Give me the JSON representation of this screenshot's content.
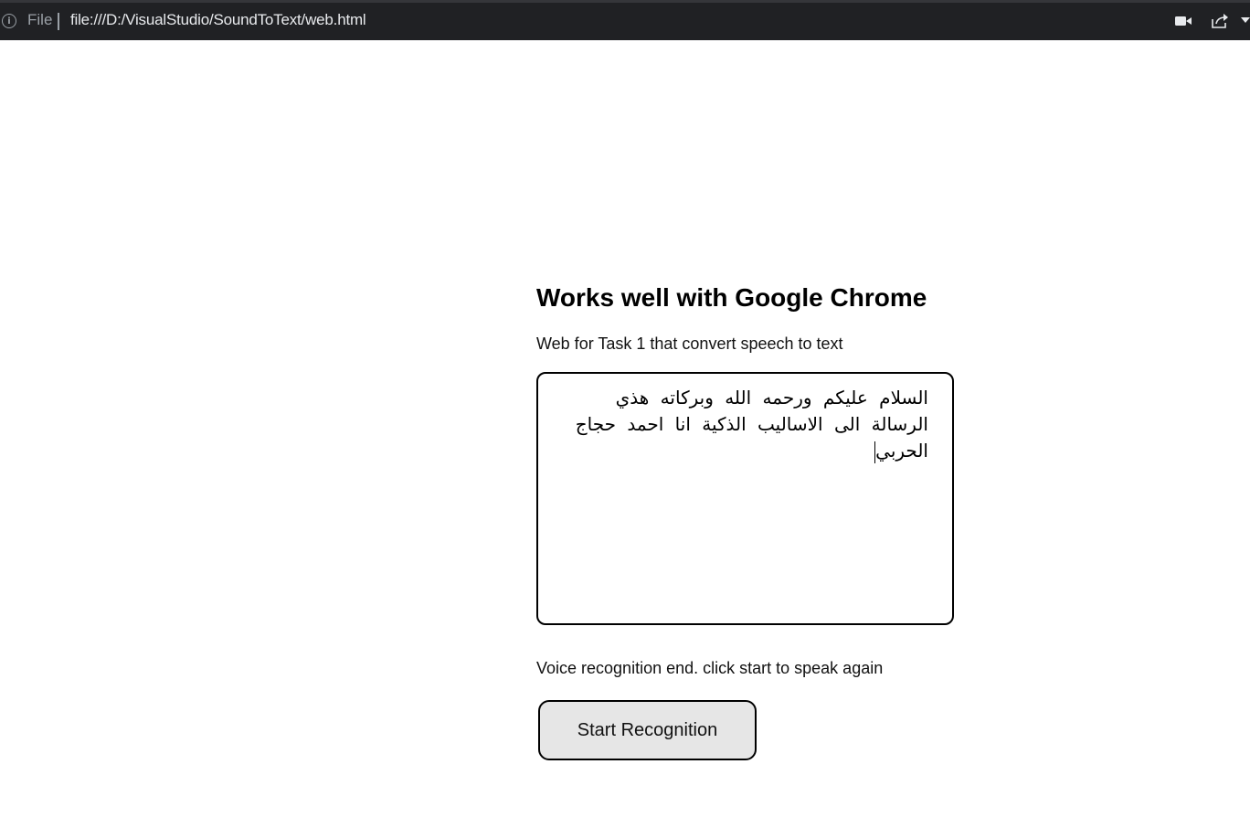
{
  "browser": {
    "scheme_label": "File",
    "url": "file:///D:/VisualStudio/SoundToText/web.html",
    "icons": [
      "info-icon",
      "camera-icon",
      "share-icon",
      "chevron-down-icon"
    ]
  },
  "page": {
    "heading": "Works well with Google Chrome",
    "subtitle": "Web for Task 1 that convert speech to text",
    "transcript": "السلام عليكم ورحمه الله وبركاته هذي الرسالة الى الاساليب الذكية انا احمد حجاج الحربي",
    "status": "Voice recognition end. click start to speak again",
    "start_button_label": "Start Recognition"
  },
  "colors": {
    "toolbar_bg": "#202124",
    "button_bg": "#e6e6e6"
  }
}
